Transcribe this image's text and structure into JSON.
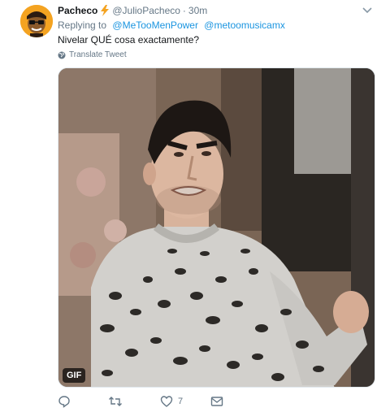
{
  "tweet": {
    "display_name": "Pacheco",
    "handle": "@JulioPacheco",
    "separator": "·",
    "time": "30m",
    "replying_label": "Replying to",
    "mentions": [
      "@MeTooMenPower",
      "@metoomusicamx"
    ],
    "text": "Nivelar QUÉ cosa exactamente?",
    "translate_label": "Translate Tweet",
    "media_badge": "GIF",
    "like_count": "7"
  },
  "icons": {
    "author_badge": "lightning-bolt-icon",
    "menu": "chevron-down-icon",
    "translate": "globe-icon",
    "reply": "reply-icon",
    "retweet": "retweet-icon",
    "like": "heart-icon",
    "dm": "envelope-icon"
  },
  "colors": {
    "accent": "#1b95e0",
    "secondary_text": "#657786",
    "bolt": "#f4a321",
    "avatar_bg": "#f4a321"
  }
}
